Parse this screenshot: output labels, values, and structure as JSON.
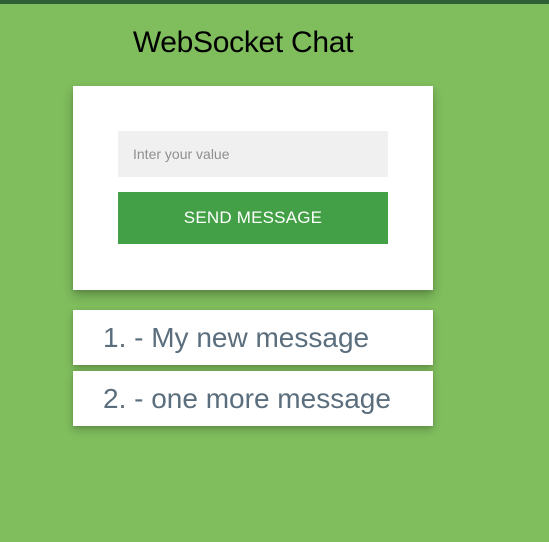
{
  "page": {
    "title": "WebSocket Chat"
  },
  "form": {
    "input_placeholder": "Inter your value",
    "input_value": "",
    "send_label": "SEND MESSAGE"
  },
  "messages": [
    {
      "text": "1. - My new message"
    },
    {
      "text": "2. - one more message"
    }
  ],
  "colors": {
    "background": "#7fbd5d",
    "top_bar": "#2e5f36",
    "button": "#43a047",
    "message_text": "#5a6e7d"
  }
}
